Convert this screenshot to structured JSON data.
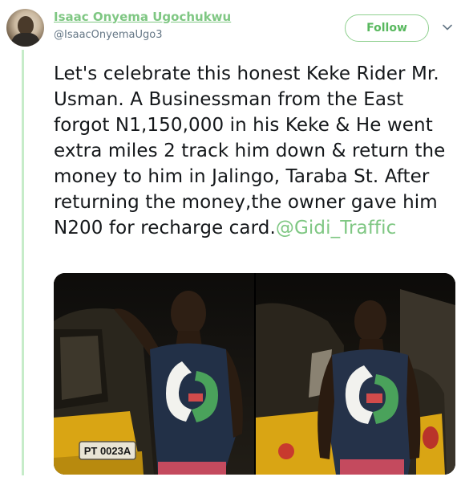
{
  "author": {
    "display_name": "Isaac Onyema Ugochukwu",
    "handle": "@IsaacOnyemaUgo3"
  },
  "follow_label": "Follow",
  "tweet": {
    "text": "Let's celebrate this honest Keke Rider Mr. Usman. A Businessman from the East forgot N1,150,000 in his Keke & He went extra miles 2 track him down & return the money to him in Jalingo, Taraba St. After returning the money,the owner gave him N200 for recharge card.",
    "mention": "@Gidi_Traffic"
  },
  "media": {
    "photo_1": {
      "plate_text": "PT 0023A"
    }
  },
  "colors": {
    "accent": "#7fc783",
    "thread_bar": "#c6ecc9",
    "keke_yellow": "#d9a514"
  }
}
